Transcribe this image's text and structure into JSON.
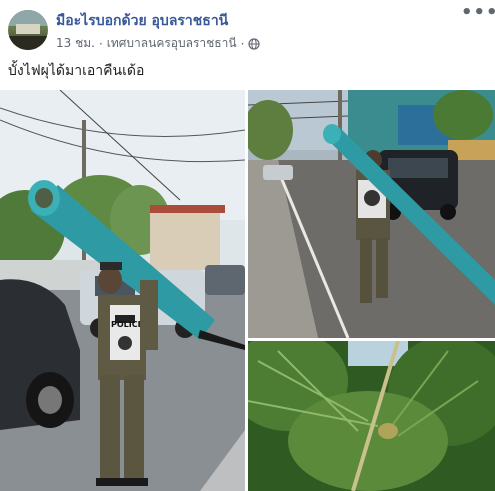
{
  "post": {
    "page_name": "มือะไรบอกด้วย อุบลราชธานี",
    "time": "13 ชม.",
    "separator": "·",
    "location": "เทศบาลนครอุบลราชธานี",
    "separator2": "·",
    "privacy_icon": "globe-icon",
    "more_icon": "more-horizontal-icon",
    "more_label": "•••",
    "caption": "บั้งไฟผุได้มาเอาคืนเด้อ"
  },
  "photos": {
    "main_badge": "POLICE",
    "items": [
      {
        "icon": "photo-police-carrying-pole"
      },
      {
        "icon": "photo-police-walking-street"
      },
      {
        "icon": "photo-palm-trees-sky"
      }
    ]
  },
  "colors": {
    "link_blue": "#385898",
    "meta_gray": "#606770",
    "pole_teal": "#2e9aa3"
  }
}
